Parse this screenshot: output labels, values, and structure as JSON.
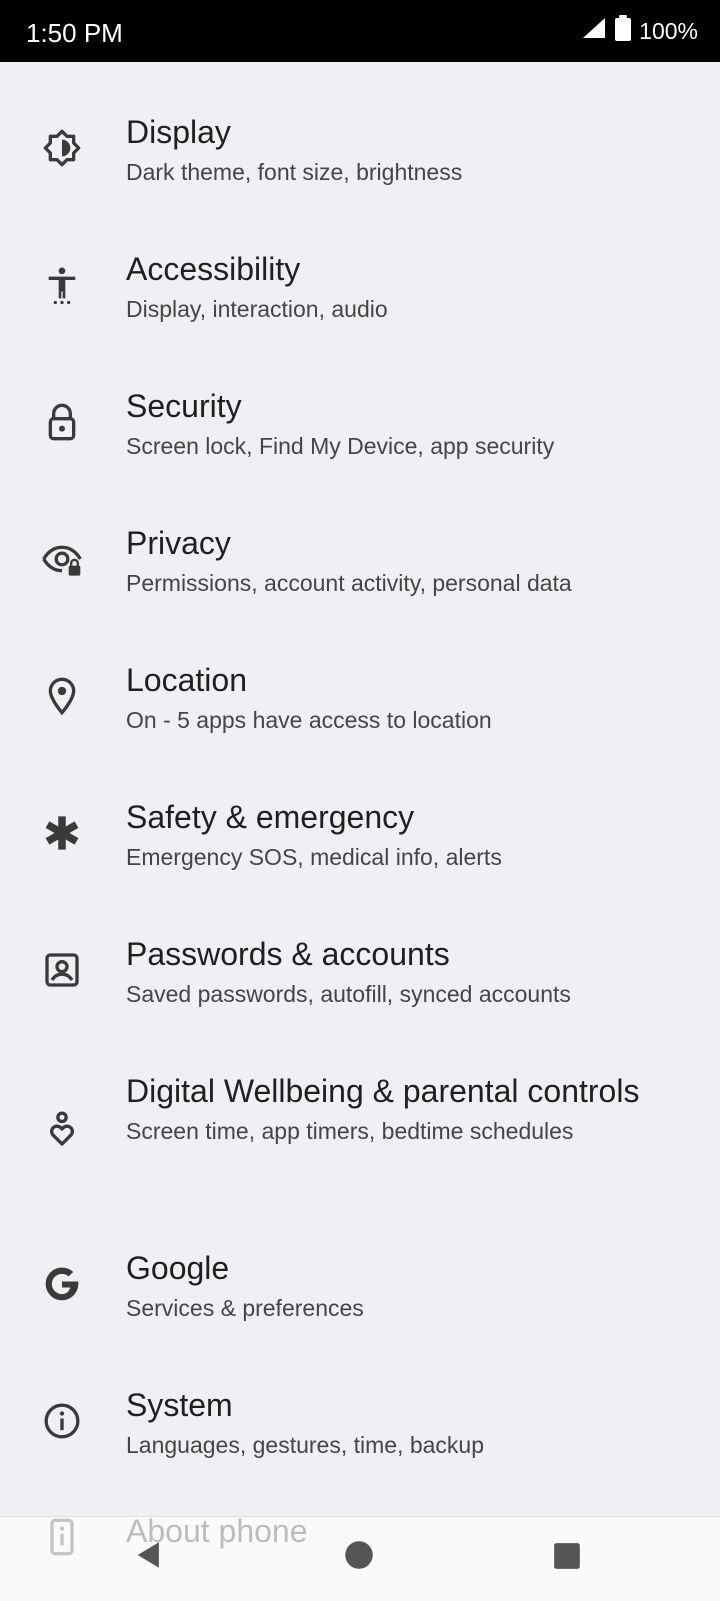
{
  "status_bar": {
    "time": "1:50 PM",
    "battery_percent": "100%",
    "signal_icon": "cell-signal-icon",
    "battery_icon": "battery-full-icon"
  },
  "settings": {
    "items": [
      {
        "title": "Display",
        "subtitle": "Dark theme, font size, brightness",
        "icon": "display-brightness-icon"
      },
      {
        "title": "Accessibility",
        "subtitle": "Display, interaction, audio",
        "icon": "accessibility-icon"
      },
      {
        "title": "Security",
        "subtitle": "Screen lock, Find My Device, app security",
        "icon": "lock-icon"
      },
      {
        "title": "Privacy",
        "subtitle": "Permissions, account activity, personal data",
        "icon": "privacy-eye-icon"
      },
      {
        "title": "Location",
        "subtitle": "On - 5 apps have access to location",
        "icon": "location-pin-icon"
      },
      {
        "title": "Safety & emergency",
        "subtitle": "Emergency SOS, medical info, alerts",
        "icon": "asterisk-icon"
      },
      {
        "title": "Passwords & accounts",
        "subtitle": "Saved passwords, autofill, synced accounts",
        "icon": "account-box-icon"
      },
      {
        "title": "Digital Wellbeing & parental controls",
        "subtitle": "Screen time, app timers, bedtime schedules",
        "icon": "wellbeing-heart-icon"
      },
      {
        "title": "Google",
        "subtitle": "Services & preferences",
        "icon": "google-g-icon"
      },
      {
        "title": "System",
        "subtitle": "Languages, gestures, time, backup",
        "icon": "info-circle-icon"
      }
    ],
    "partial_item": {
      "title": "About phone",
      "icon": "phone-info-icon"
    }
  },
  "nav_bar": {
    "back_icon": "back-triangle-icon",
    "home_icon": "home-circle-icon",
    "recents_icon": "recents-square-icon"
  },
  "colors": {
    "background": "#f0eff4",
    "status_bar": "#000000",
    "title_text": "#1f1f1f",
    "subtitle_text": "#454545",
    "icon": "#3a3a3a"
  }
}
